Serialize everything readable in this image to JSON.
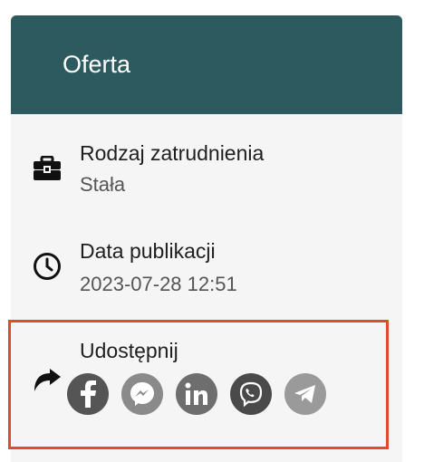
{
  "offer": {
    "title": "Oferta",
    "employment": {
      "label": "Rodzaj zatrudnienia",
      "value": "Stała",
      "icon": "briefcase-icon"
    },
    "published": {
      "label": "Data publikacji",
      "value": "2023-07-28 12:51",
      "icon": "clock-icon"
    },
    "share": {
      "label": "Udostępnij",
      "icon": "share-arrow-icon",
      "networks": [
        {
          "name": "facebook",
          "color": "#555555"
        },
        {
          "name": "messenger",
          "color": "#8a8a8a"
        },
        {
          "name": "linkedin",
          "color": "#6e6e6e"
        },
        {
          "name": "viber",
          "color": "#4a4a4a"
        },
        {
          "name": "telegram",
          "color": "#9a9a9a"
        }
      ]
    }
  },
  "colors": {
    "header": "#2d5a5e",
    "highlight": "#e04b2f"
  }
}
